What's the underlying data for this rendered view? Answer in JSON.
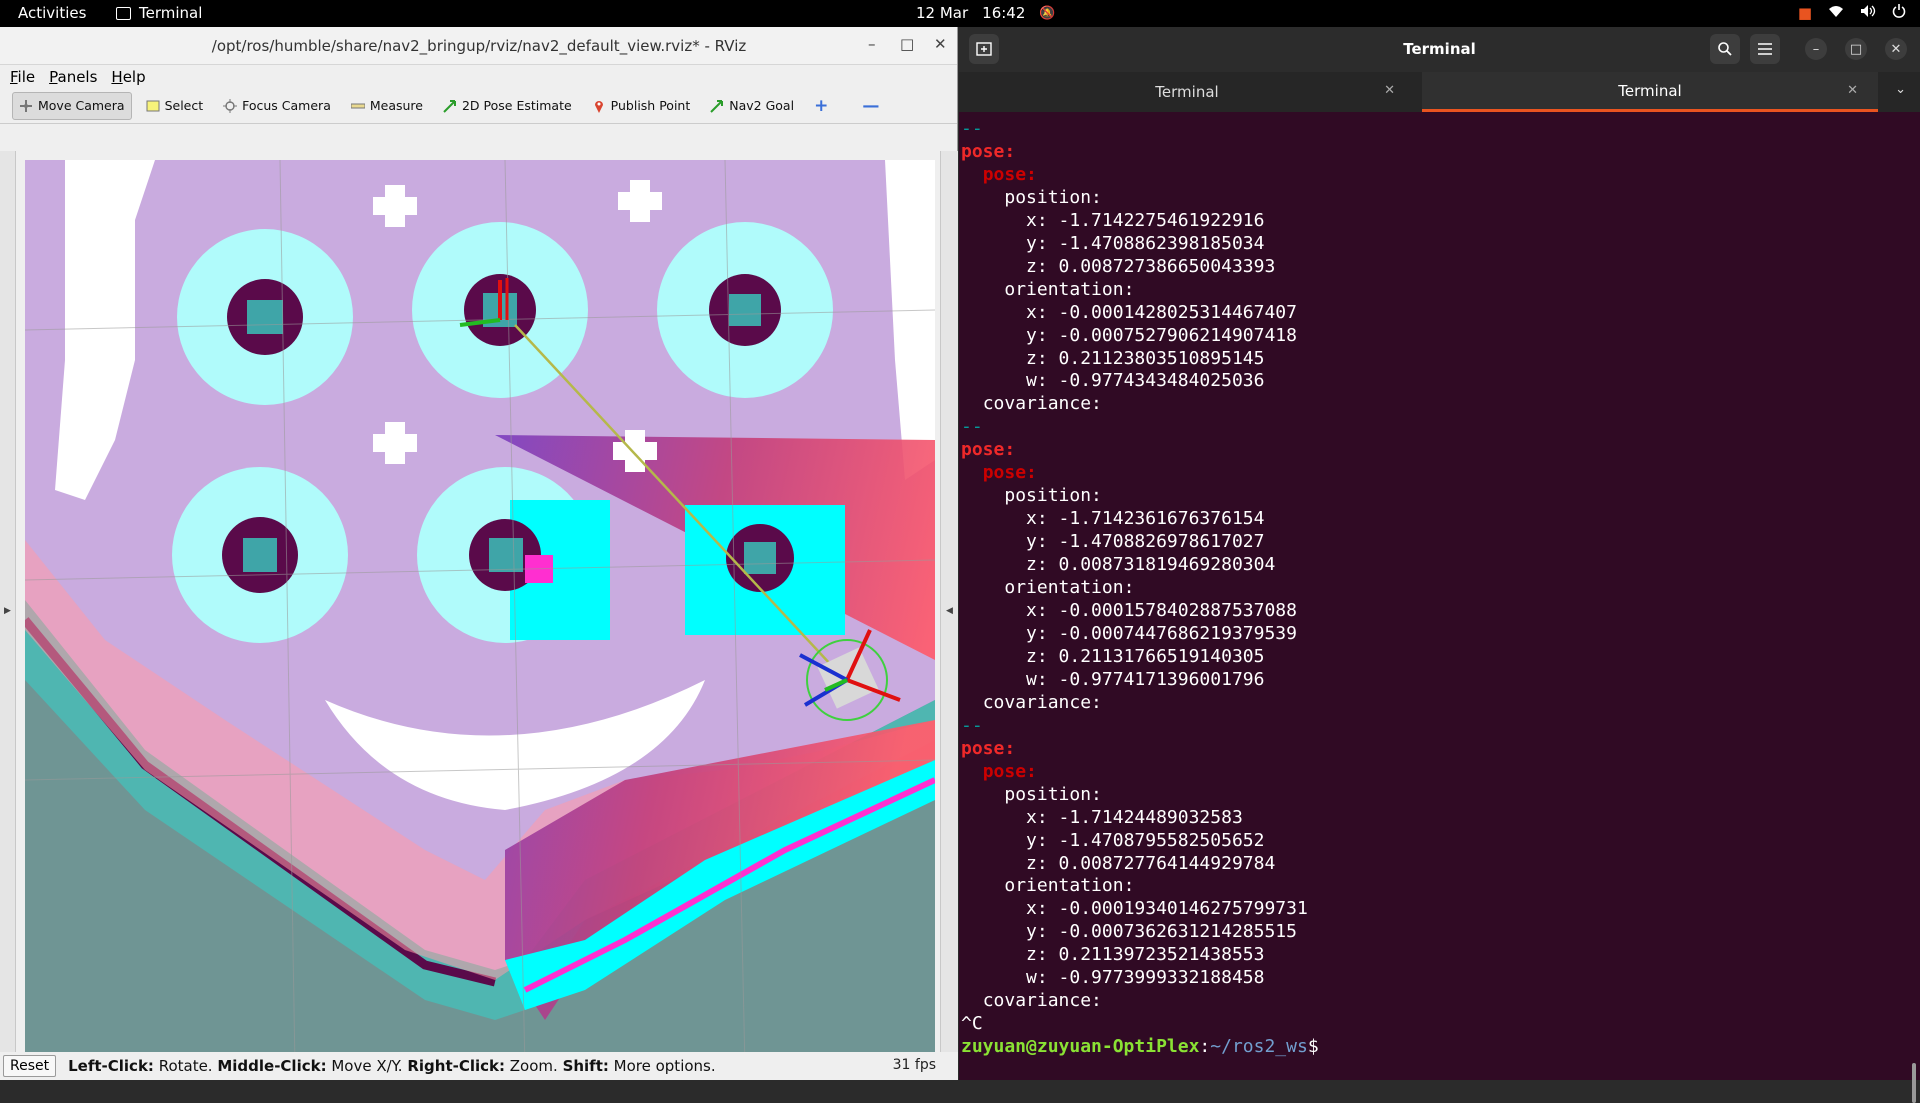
{
  "topbar": {
    "activities": "Activities",
    "app_name": "Terminal",
    "date": "12 Mar",
    "time": "16:42"
  },
  "rviz": {
    "title": "/opt/ros/humble/share/nav2_bringup/rviz/nav2_default_view.rviz* - RViz",
    "menu": [
      "File",
      "Panels",
      "Help"
    ],
    "tools": [
      {
        "label": "Move Camera",
        "icon": "move-camera-icon",
        "active": true
      },
      {
        "label": "Select",
        "icon": "select-icon"
      },
      {
        "label": "Focus Camera",
        "icon": "focus-camera-icon"
      },
      {
        "label": "Measure",
        "icon": "ruler-icon"
      },
      {
        "label": "2D Pose Estimate",
        "icon": "green-arrow-icon"
      },
      {
        "label": "Publish Point",
        "icon": "map-pin-icon"
      },
      {
        "label": "Nav2 Goal",
        "icon": "green-arrow-icon"
      }
    ],
    "status": {
      "reset": "Reset",
      "hint_parts": [
        {
          "b": "Left-Click:",
          "t": " Rotate. "
        },
        {
          "b": "Middle-Click:",
          "t": " Move X/Y. "
        },
        {
          "b": "Right-Click:",
          "t": " Zoom. "
        },
        {
          "b": "Shift:",
          "t": " More options."
        }
      ],
      "fps": "31 fps"
    },
    "colors": {
      "free_space": "#ffffff",
      "inflation_outer": "#c8a8dc",
      "inflation_high": "#ff9aa8",
      "obstacle_cyan": "#00ffff",
      "lethal": "#5a0a4a",
      "unknown": "#6f9594"
    }
  },
  "terminal": {
    "title": "Terminal",
    "tabs": [
      "Terminal",
      "Terminal"
    ],
    "active_tab": 1,
    "poses": [
      {
        "pos": {
          "x": "-1.7142275461922916",
          "y": "-1.4708862398185034",
          "z": "0.008727386650043393"
        },
        "ori": {
          "x": "-0.00014280253144674​07",
          "y": "-0.0007527906214907418",
          "z": "0.21123803510895145",
          "w": "-0.9774343484025036"
        }
      },
      {
        "pos": {
          "x": "-1.7142361676376154",
          "y": "-1.4708826978617027",
          "z": "0.008731819469280304"
        },
        "ori": {
          "x": "-0.0001578402887537088",
          "y": "-0.0007447686219379539",
          "z": "0.21131766519140305",
          "w": "-0.9774171396001796"
        }
      },
      {
        "pos": {
          "x": "-1.71424489032583",
          "y": "-1.4708795582505652",
          "z": "0.008727764144929784"
        },
        "ori": {
          "x": "-0.00019340146275799731",
          "y": "-0.0007362631214285515",
          "z": "0.21139723521438553",
          "w": "-0.9773999332188458"
        }
      }
    ],
    "labels": {
      "sep": "--",
      "pose": "pose:",
      "position": "position:",
      "orientation": "orientation:",
      "covariance": "covariance:"
    },
    "interrupt": "^C",
    "prompt_user": "zuyuan@zuyuan-OptiPlex",
    "prompt_path": "~/ros2_ws",
    "prompt_sym": "$"
  }
}
